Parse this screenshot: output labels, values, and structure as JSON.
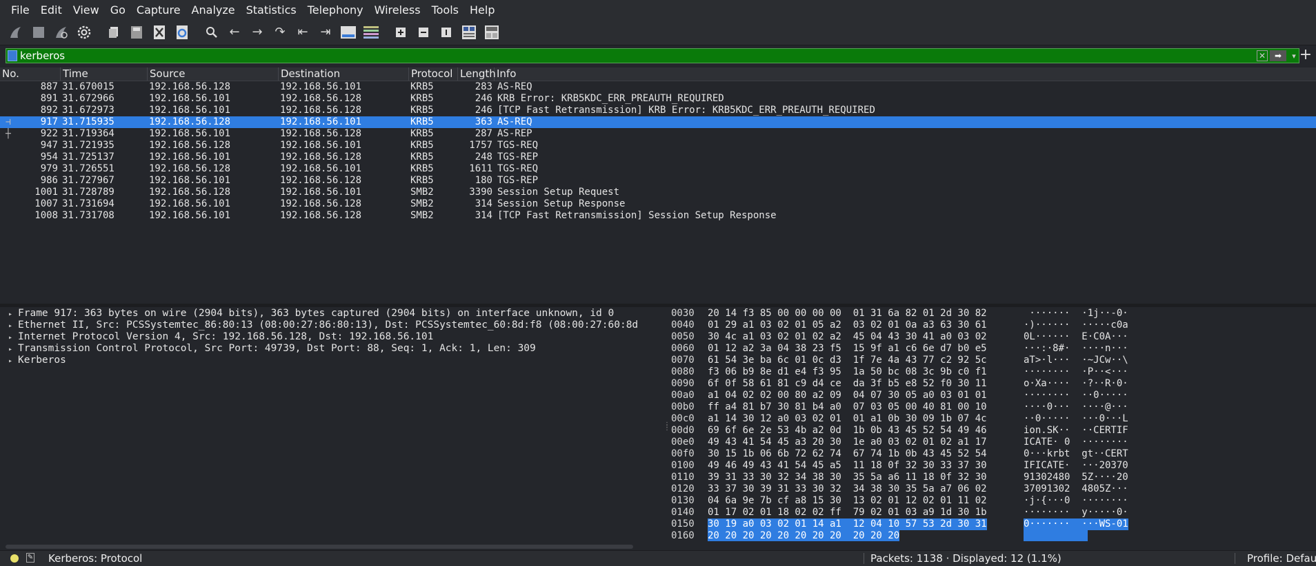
{
  "menu": [
    "File",
    "Edit",
    "View",
    "Go",
    "Capture",
    "Analyze",
    "Statistics",
    "Telephony",
    "Wireless",
    "Tools",
    "Help"
  ],
  "toolbar_icons": [
    "shark-fin-start-icon",
    "stop-icon",
    "restart-icon",
    "options-gear-icon",
    "open-file-icon",
    "save-file-icon",
    "close-file-icon",
    "reload-icon",
    "find-icon",
    "go-back-icon",
    "go-forward-icon",
    "go-to-packet-icon",
    "first-packet-icon",
    "last-packet-icon",
    "autoscroll-icon",
    "colorize-icon",
    "zoom-in-icon",
    "zoom-out-icon",
    "normal-size-icon",
    "resize-columns-icon",
    "split-panes-icon"
  ],
  "filter": {
    "value": "kerberos",
    "bar_color": "#0a7a0a"
  },
  "columns": [
    "No.",
    "Time",
    "Source",
    "Destination",
    "Protocol",
    "Length",
    "Info"
  ],
  "packets": [
    {
      "no": "887",
      "time": "31.670015",
      "src": "192.168.56.128",
      "dst": "192.168.56.101",
      "proto": "KRB5",
      "len": "283",
      "info": "AS-REQ"
    },
    {
      "no": "891",
      "time": "31.672966",
      "src": "192.168.56.101",
      "dst": "192.168.56.128",
      "proto": "KRB5",
      "len": "246",
      "info": "KRB Error: KRB5KDC_ERR_PREAUTH_REQUIRED"
    },
    {
      "no": "892",
      "time": "31.672973",
      "src": "192.168.56.101",
      "dst": "192.168.56.128",
      "proto": "KRB5",
      "len": "246",
      "info": "[TCP Fast Retransmission] KRB Error: KRB5KDC_ERR_PREAUTH_REQUIRED"
    },
    {
      "no": "917",
      "time": "31.715935",
      "src": "192.168.56.128",
      "dst": "192.168.56.101",
      "proto": "KRB5",
      "len": "363",
      "info": "AS-REQ",
      "selected": true
    },
    {
      "no": "922",
      "time": "31.719364",
      "src": "192.168.56.101",
      "dst": "192.168.56.128",
      "proto": "KRB5",
      "len": "287",
      "info": "AS-REP"
    },
    {
      "no": "947",
      "time": "31.721935",
      "src": "192.168.56.128",
      "dst": "192.168.56.101",
      "proto": "KRB5",
      "len": "1757",
      "info": "TGS-REQ"
    },
    {
      "no": "954",
      "time": "31.725137",
      "src": "192.168.56.101",
      "dst": "192.168.56.128",
      "proto": "KRB5",
      "len": "248",
      "info": "TGS-REP"
    },
    {
      "no": "979",
      "time": "31.726551",
      "src": "192.168.56.128",
      "dst": "192.168.56.101",
      "proto": "KRB5",
      "len": "1611",
      "info": "TGS-REQ"
    },
    {
      "no": "986",
      "time": "31.727967",
      "src": "192.168.56.101",
      "dst": "192.168.56.128",
      "proto": "KRB5",
      "len": "180",
      "info": "TGS-REP"
    },
    {
      "no": "1001",
      "time": "31.728789",
      "src": "192.168.56.128",
      "dst": "192.168.56.101",
      "proto": "SMB2",
      "len": "3390",
      "info": "Session Setup Request"
    },
    {
      "no": "1007",
      "time": "31.731694",
      "src": "192.168.56.101",
      "dst": "192.168.56.128",
      "proto": "SMB2",
      "len": "314",
      "info": "Session Setup Response"
    },
    {
      "no": "1008",
      "time": "31.731708",
      "src": "192.168.56.101",
      "dst": "192.168.56.128",
      "proto": "SMB2",
      "len": "314",
      "info": "[TCP Fast Retransmission] Session Setup Response"
    }
  ],
  "details": [
    "Frame 917: 363 bytes on wire (2904 bits), 363 bytes captured (2904 bits) on interface unknown, id 0",
    "Ethernet II, Src: PCSSystemtec_86:80:13 (08:00:27:86:80:13), Dst: PCSSystemtec_60:8d:f8 (08:00:27:60:8d",
    "Internet Protocol Version 4, Src: 192.168.56.128, Dst: 192.168.56.101",
    "Transmission Control Protocol, Src Port: 49739, Dst Port: 88, Seq: 1, Ack: 1, Len: 309",
    "Kerberos"
  ],
  "bytes": [
    {
      "off": "0030",
      "hex": "20 14 f3 85 00 00 00 00  01 31 6a 82 01 2d 30 82",
      "ascii": " ·······  ·1j··-0·"
    },
    {
      "off": "0040",
      "hex": "01 29 a1 03 02 01 05 a2  03 02 01 0a a3 63 30 61",
      "ascii": "·)······  ·····c0a"
    },
    {
      "off": "0050",
      "hex": "30 4c a1 03 02 01 02 a2  45 04 43 30 41 a0 03 02",
      "ascii": "0L······  E·C0A···"
    },
    {
      "off": "0060",
      "hex": "01 12 a2 3a 04 38 23 f5  15 9f a1 c6 6e d7 b0 e5",
      "ascii": "···:·8#·  ····n···"
    },
    {
      "off": "0070",
      "hex": "61 54 3e ba 6c 01 0c d3  1f 7e 4a 43 77 c2 92 5c",
      "ascii": "aT>·l···  ·~JCw··\\"
    },
    {
      "off": "0080",
      "hex": "f3 06 b9 8e d1 e4 f3 95  1a 50 bc 08 3c 9b c0 f1",
      "ascii": "········  ·P··<···"
    },
    {
      "off": "0090",
      "hex": "6f 0f 58 61 81 c9 d4 ce  da 3f b5 e8 52 f0 30 11",
      "ascii": "o·Xa····  ·?··R·0·"
    },
    {
      "off": "00a0",
      "hex": "a1 04 02 02 00 80 a2 09  04 07 30 05 a0 03 01 01",
      "ascii": "········  ··0·····"
    },
    {
      "off": "00b0",
      "hex": "ff a4 81 b7 30 81 b4 a0  07 03 05 00 40 81 00 10",
      "ascii": "····0···  ····@···"
    },
    {
      "off": "00c0",
      "hex": "a1 14 30 12 a0 03 02 01  01 a1 0b 30 09 1b 07 4c",
      "ascii": "··0·····  ···0···L"
    },
    {
      "off": "00d0",
      "hex": "69 6f 6e 2e 53 4b a2 0d  1b 0b 43 45 52 54 49 46",
      "ascii": "ion.SK··  ··CERTIF"
    },
    {
      "off": "00e0",
      "hex": "49 43 41 54 45 a3 20 30  1e a0 03 02 01 02 a1 17",
      "ascii": "ICATE· 0  ········"
    },
    {
      "off": "00f0",
      "hex": "30 15 1b 06 6b 72 62 74  67 74 1b 0b 43 45 52 54",
      "ascii": "0···krbt  gt··CERT"
    },
    {
      "off": "0100",
      "hex": "49 46 49 43 41 54 45 a5  11 18 0f 32 30 33 37 30",
      "ascii": "IFICATE·  ···20370"
    },
    {
      "off": "0110",
      "hex": "39 31 33 30 32 34 38 30  35 5a a6 11 18 0f 32 30",
      "ascii": "91302480  5Z····20"
    },
    {
      "off": "0120",
      "hex": "33 37 30 39 31 33 30 32  34 38 30 35 5a a7 06 02",
      "ascii": "37091302  4805Z···"
    },
    {
      "off": "0130",
      "hex": "04 6a 9e 7b cf a8 15 30  13 02 01 12 02 01 11 02",
      "ascii": "·j·{···0  ········"
    },
    {
      "off": "0140",
      "hex": "01 17 02 01 18 02 02 ff  79 02 01 03 a9 1d 30 1b",
      "ascii": "········  y·····0·"
    },
    {
      "off": "0150",
      "hex": "30 19 a0 03 02 01 14 a1  12 04 10 57 53 2d 30 31",
      "ascii": "0·······  ···WS-01",
      "hl": true
    },
    {
      "off": "0160",
      "hex": "20 20 20 20 20 20 20 20  20 20 20",
      "ascii": "           ",
      "hl": true
    }
  ],
  "status": {
    "profile_text": "Kerberos: Protocol",
    "packets_text": "Packets: 1138 · Displayed: 12 (1.1%)",
    "profile": "Profile: Default"
  }
}
